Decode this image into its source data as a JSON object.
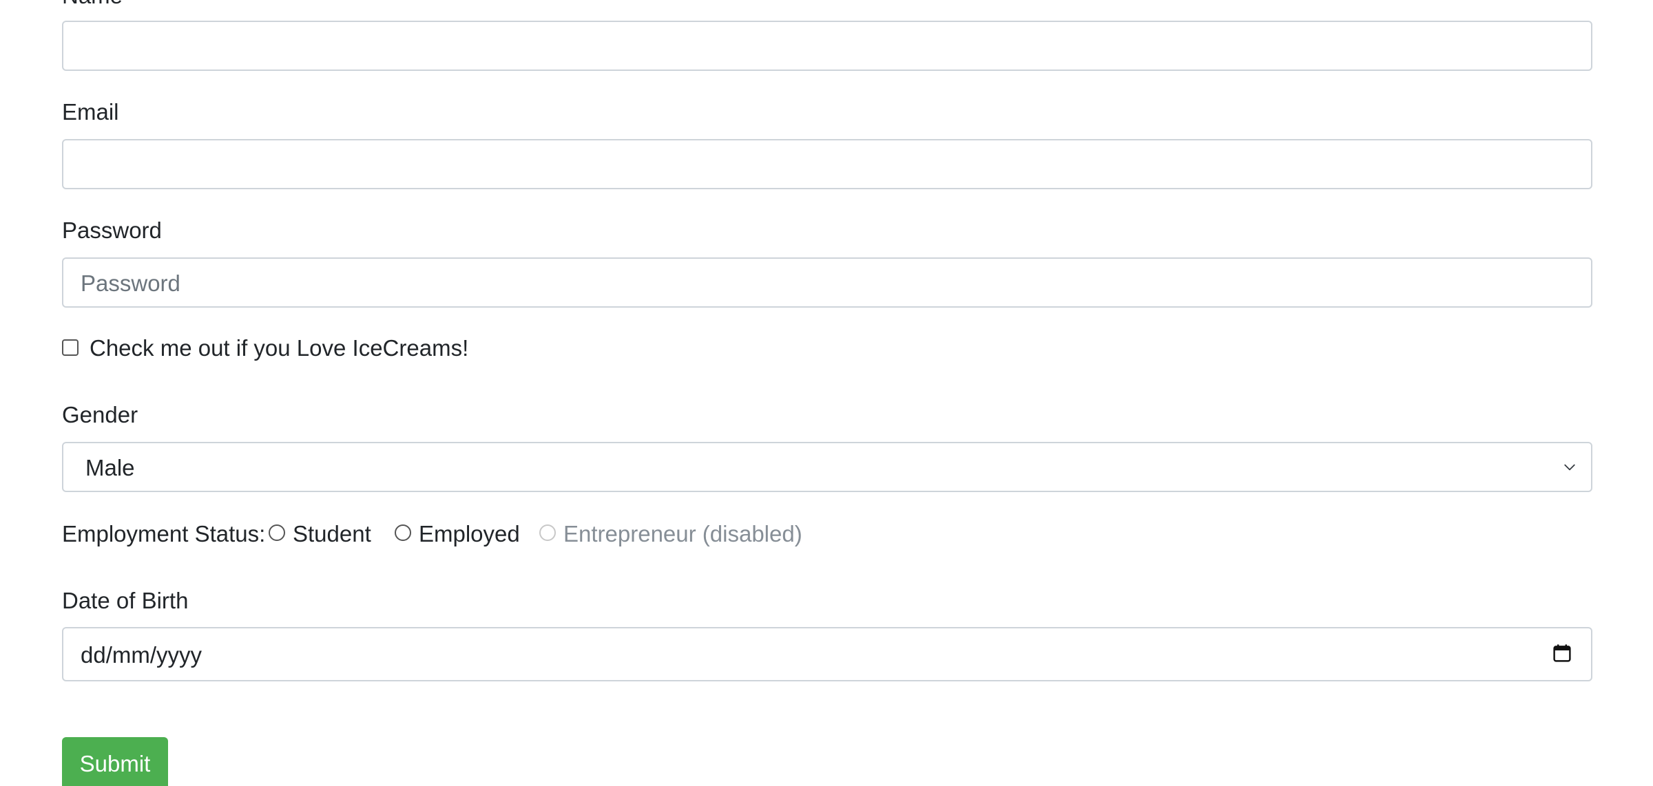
{
  "form": {
    "name": {
      "label": "Name",
      "value": ""
    },
    "email": {
      "label": "Email",
      "value": ""
    },
    "password": {
      "label": "Password",
      "placeholder": "Password"
    },
    "checkbox": {
      "label": "Check me out if you Love IceCreams!",
      "checked": false
    },
    "gender": {
      "label": "Gender",
      "selected": "Male"
    },
    "employment": {
      "label": "Employment Status:",
      "options": [
        {
          "label": "Student",
          "selected": false,
          "disabled": false
        },
        {
          "label": "Employed",
          "selected": false,
          "disabled": false
        },
        {
          "label": "Entrepreneur (disabled)",
          "selected": false,
          "disabled": true
        }
      ]
    },
    "dob": {
      "label": "Date of Birth",
      "placeholder": "dd/mm/yyyy"
    },
    "submit_label": "Submit"
  },
  "colors": {
    "submit_bg": "#4caf50",
    "border": "#ced4da",
    "disabled_text": "#868e96"
  },
  "icons": {
    "select": "chevron-down-icon",
    "date": "calendar-icon"
  }
}
